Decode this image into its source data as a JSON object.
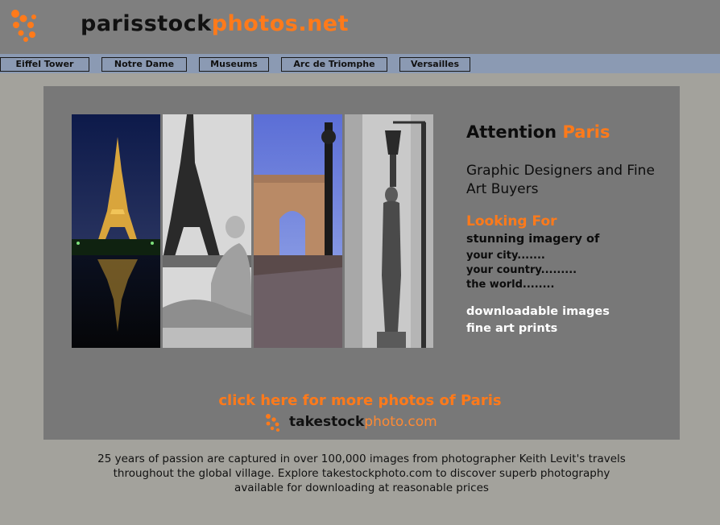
{
  "header": {
    "logo_icon": "orange-dots-logo-icon",
    "site_title_part1": "parisstock",
    "site_title_part2": "photos.net",
    "brand_color": "#ff7a1a"
  },
  "nav": {
    "items": [
      {
        "label": "Eiffel Tower"
      },
      {
        "label": "Notre Dame"
      },
      {
        "label": "Museums"
      },
      {
        "label": "Arc de Triomphe"
      },
      {
        "label": "Versailles"
      }
    ]
  },
  "promo": {
    "attention": "Attention",
    "attention_city": "Paris",
    "audience": "Graphic Designers and Fine Art Buyers",
    "looking_for": "Looking For",
    "stunning": "stunning imagery of",
    "city": "your city.......",
    "country": "your country.........",
    "world": "the world........",
    "downloadable": "downloadable images",
    "prints": "fine art prints"
  },
  "cta": {
    "link_text": "click here for more photos of Paris",
    "brand_part1": "takestock",
    "brand_part2": "photo.com"
  },
  "footer": {
    "text": "25 years of passion are captured in over 100,000 images from photographer Keith Levit's travels throughout the global village. Explore takestockphoto.com to discover superb photography available for downloading at reasonable prices"
  }
}
